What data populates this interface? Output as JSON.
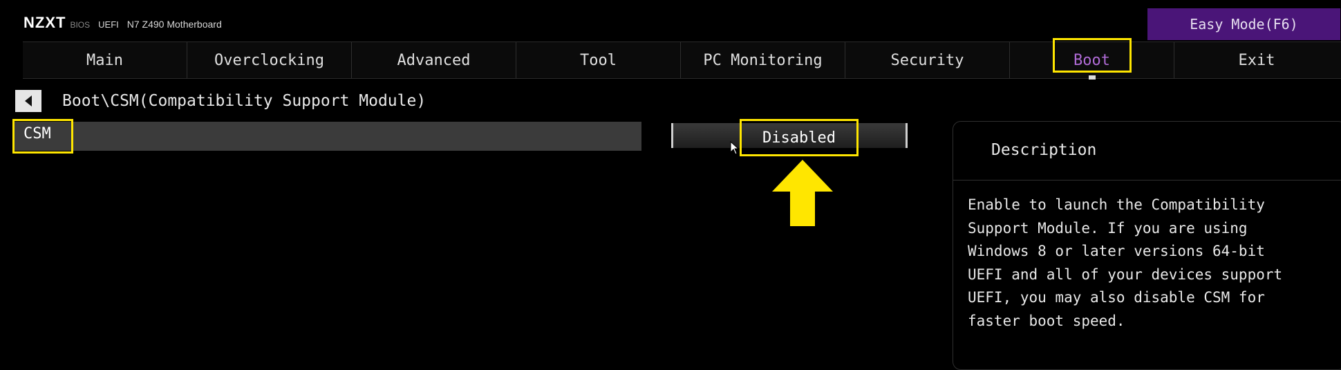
{
  "header": {
    "brand": "NZXT",
    "bios": "BIOS",
    "uefi": "UEFI",
    "model": "N7 Z490 Motherboard",
    "easy_mode": "Easy Mode(F6)",
    "colors": {
      "accent_purple": "#4a1578",
      "highlight_yellow": "#ffe600"
    }
  },
  "tabs": [
    {
      "label": "Main"
    },
    {
      "label": "Overclocking"
    },
    {
      "label": "Advanced"
    },
    {
      "label": "Tool"
    },
    {
      "label": "PC Monitoring"
    },
    {
      "label": "Security"
    },
    {
      "label": "Boot",
      "active": true
    },
    {
      "label": "Exit"
    }
  ],
  "breadcrumb": {
    "back_icon": "left-triangle-icon",
    "path": "Boot\\CSM(Compatibility Support Module)"
  },
  "setting": {
    "label": "CSM",
    "value": "Disabled"
  },
  "description": {
    "title": "Description",
    "text": "Enable to launch the Compatibility\nSupport Module. If you are using\nWindows 8 or later versions 64-bit\nUEFI and all of your devices support\nUEFI, you may also disable CSM for\nfaster boot speed."
  }
}
